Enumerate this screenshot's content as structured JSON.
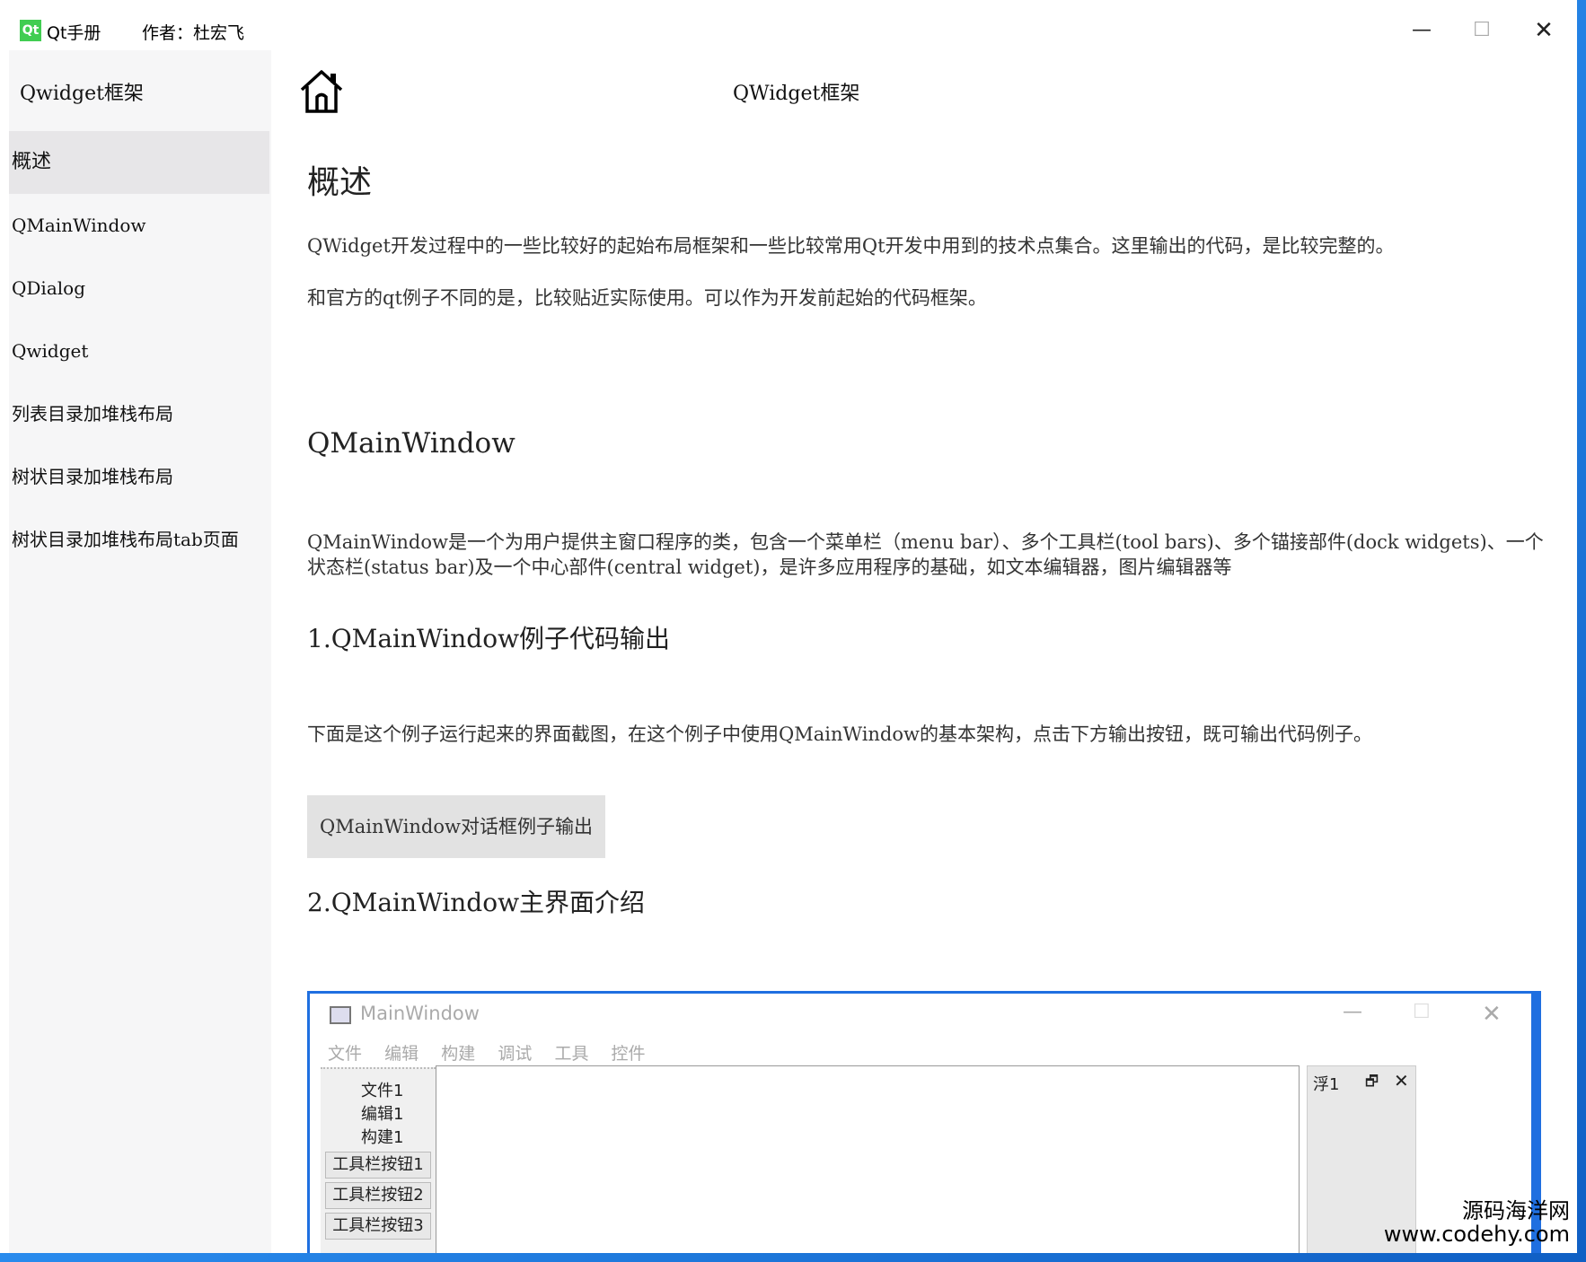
{
  "titlebar": {
    "logo_text": "Qt",
    "app_name": "Qt手册",
    "author": "作者：杜宏飞",
    "minimize": "—",
    "maximize": "☐",
    "close": "✕"
  },
  "sidebar": {
    "title": "Qwidget框架",
    "items": [
      {
        "label": "概述",
        "active": true
      },
      {
        "label": "QMainWindow"
      },
      {
        "label": "QDialog"
      },
      {
        "label": "Qwidget"
      },
      {
        "label": "列表目录加堆栈布局"
      },
      {
        "label": "树状目录加堆栈布局"
      },
      {
        "label": "树状目录加堆栈布局tab页面"
      }
    ]
  },
  "content": {
    "page_title": "QWidget框架",
    "overview_heading": "概述",
    "overview_line1": "        QWidget开发过程中的一些比较好的起始布局框架和一些比较常用Qt开发中用到的技术点集合。这里输出的代码，是比较完整的。",
    "overview_line2": "和官方的qt例子不同的是，比较贴近实际使用。可以作为开发前起始的代码框架。",
    "qmw_heading": "QMainWindow",
    "qmw_desc": "    QMainWindow是一个为用户提供主窗口程序的类，包含一个菜单栏（menu bar）、多个工具栏(tool bars)、多个锚接部件(dock widgets)、一个状态栏(status bar)及一个中心部件(central widget)，是许多应用程序的基础，如文本编辑器，图片编辑器等",
    "section1": "1.QMainWindow例子代码输出",
    "section1_desc": "下面是这个例子运行起来的界面截图，在这个例子中使用QMainWindow的基本架构，点击下方输出按钮，既可输出代码例子。",
    "output_button": "QMainWindow对话框例子输出",
    "section2": "2.QMainWindow主界面介绍"
  },
  "screenshot": {
    "title": "MainWindow",
    "minimize": "—",
    "maximize": "☐",
    "close": "✕",
    "menus": [
      "文件",
      "编辑",
      "构建",
      "调试",
      "工具",
      "控件"
    ],
    "toolbar_labels": [
      "文件1",
      "编辑1",
      "构建1"
    ],
    "toolbar_buttons": [
      "工具栏按钮1",
      "工具栏按钮2",
      "工具栏按钮3"
    ],
    "dock_title": "浮1",
    "dock_float": "🗗",
    "dock_close": "✕"
  },
  "watermark": {
    "line1": "源码海洋网",
    "line2": "www.codehy.com"
  }
}
